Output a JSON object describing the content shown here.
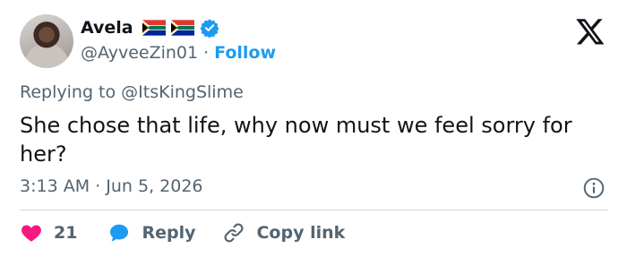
{
  "author": {
    "display_name": "Avela",
    "handle": "@AyveeZin01",
    "follow_label": "Follow",
    "separator": "·",
    "flags": [
      "south-africa-flag",
      "south-africa-flag"
    ],
    "verified": true
  },
  "tweet": {
    "reply_prefix": "Replying to",
    "reply_to": "@ItsKingSlime",
    "text": "She chose that life, why now must we feel sorry for her?",
    "time": "3:13 AM",
    "date": "Jun 5, 2026",
    "meta_separator": "·"
  },
  "actions": {
    "like_count": "21",
    "reply_label": "Reply",
    "copy_link_label": "Copy link"
  },
  "colors": {
    "accent": "#1d9bf0",
    "like": "#f91880",
    "muted": "#536471",
    "text": "#0f1419"
  }
}
